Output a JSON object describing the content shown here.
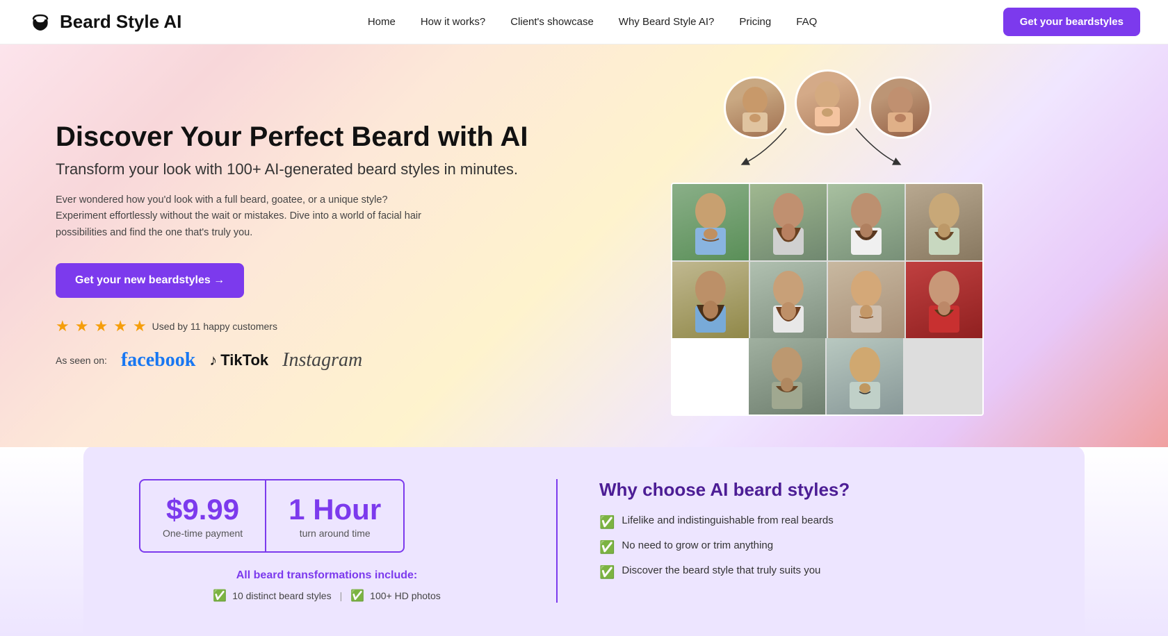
{
  "nav": {
    "logo_text": "Beard Style AI",
    "links": [
      "Home",
      "How it works?",
      "Client's showcase",
      "Why Beard Style AI?",
      "Pricing",
      "FAQ"
    ],
    "cta_label": "Get your beardstyles"
  },
  "hero": {
    "title": "Discover Your Perfect Beard with AI",
    "subtitle": "Transform your look with 100+ AI-generated beard styles in minutes.",
    "description": "Ever wondered how you'd look with a full beard, goatee, or a unique style? Experiment effortlessly without the wait or mistakes. Dive into a world of facial hair possibilities and find the one that's truly you.",
    "cta_label": "Get your new beardstyles →",
    "social_label": "As seen on:",
    "social_facebook": "facebook",
    "social_tiktok": "TikTok",
    "social_instagram": "Instagram",
    "stars_count": "5",
    "customers_label": "Used by 11 happy customers"
  },
  "pricing": {
    "price": "$9.99",
    "price_label": "One-time payment",
    "hour": "1 Hour",
    "hour_label": "turn around time",
    "includes_title": "All beard transformations include:",
    "includes_item1": "10 distinct beard styles",
    "includes_item2": "100+ HD photos",
    "why_title": "Why choose AI beard styles?",
    "why_items": [
      "Lifelike and indistinguishable from real beards",
      "No need to grow or trim anything",
      "Discover the beard style that truly suits you"
    ]
  }
}
